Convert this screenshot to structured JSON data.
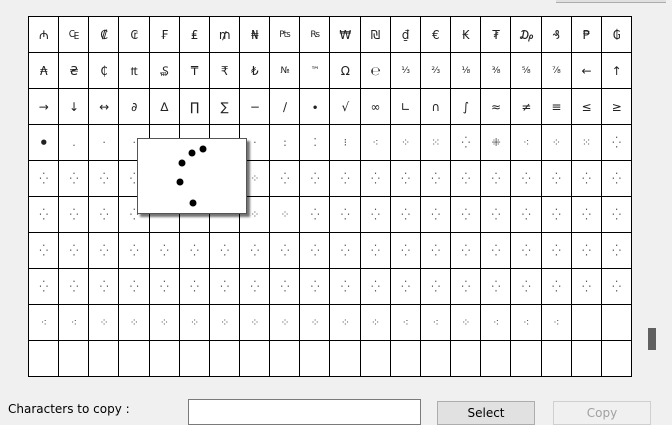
{
  "character_grid": {
    "rows": [
      [
        "₼",
        "₠",
        "₡",
        "₢",
        "₣",
        "₤",
        "₥",
        "₦",
        "₧",
        "₨",
        "₩",
        "₪",
        "₫",
        "€",
        "₭",
        "₮",
        "₯",
        "₰",
        "₱",
        "₲"
      ],
      [
        "₳",
        "₴",
        "₵",
        "₶",
        "₷",
        "₸",
        "₹",
        "₺",
        "№",
        "™",
        "Ω",
        "℮",
        "⅓",
        "⅔",
        "⅛",
        "⅜",
        "⅝",
        "⅞",
        "←",
        "↑"
      ],
      [
        "→",
        "↓",
        "↔",
        "∂",
        "∆",
        "∏",
        "∑",
        "−",
        "∕",
        "∙",
        "√",
        "∞",
        "∟",
        "∩",
        "∫",
        "≈",
        "≠",
        "≡",
        "≤",
        "≥"
      ],
      [
        "•",
        ".",
        "·",
        "·",
        "",
        "",
        "",
        "·",
        ":",
        "⁚",
        "⁝",
        "⁖",
        "⁘",
        "⁙",
        "⁛",
        "⁜",
        "⁖",
        "⁘",
        "⁙",
        "⁛"
      ],
      [
        "⁛",
        "⁛",
        "⁛",
        "⁛",
        "",
        "",
        "",
        "⁘",
        "⁛",
        "⁛",
        "⁛",
        "⁛",
        "⁛",
        "⁛",
        "⁛",
        "⁛",
        "⁛",
        "⁛",
        "⁛",
        "⁛"
      ],
      [
        "⁛",
        "⁛",
        "⁛",
        "⁛",
        "",
        "",
        "",
        "⁘",
        "⁘",
        "⁛",
        "⁛",
        "⁛",
        "⁛",
        "⁛",
        "⁛",
        "⁛",
        "⁛",
        "⁛",
        "⁛",
        "⁛"
      ],
      [
        "⁛",
        "⁛",
        "⁛",
        "⁛",
        "⁛",
        "⁛",
        "⁛",
        "⁛",
        "⁛",
        "⁛",
        "⁛",
        "⁛",
        "⁛",
        "⁛",
        "⁛",
        "⁛",
        "⁛",
        "⁛",
        "⁛",
        "⁛"
      ],
      [
        "⁛",
        "⁛",
        "⁛",
        "⁛",
        "⁛",
        "⁛",
        "⁛",
        "⁛",
        "⁛",
        "⁛",
        "⁛",
        "⁛",
        "⁛",
        "⁛",
        "⁛",
        "⁛",
        "⁛",
        "⁛",
        "⁛",
        "⁛"
      ],
      [
        "⁖",
        "⁖",
        "⁘",
        "⁘",
        "⁘",
        "⁘",
        "⁘",
        "⁘",
        "⁘",
        "⁘",
        "⁘",
        "⁘",
        "⁖",
        "⁖",
        "⁘",
        "⁖",
        "⁖",
        "⁖",
        "",
        ""
      ],
      [
        "",
        "",
        "",
        "",
        "",
        "",
        "",
        "",
        "",
        "",
        "",
        "",
        "",
        "",
        "",
        "",
        "",
        "",
        "",
        ""
      ]
    ]
  },
  "magnifier": {
    "glyph": "⁛"
  },
  "footer": {
    "characters_to_copy_label": "Characters to copy :",
    "characters_to_copy_value": "",
    "select_label": "Select",
    "copy_label": "Copy"
  }
}
